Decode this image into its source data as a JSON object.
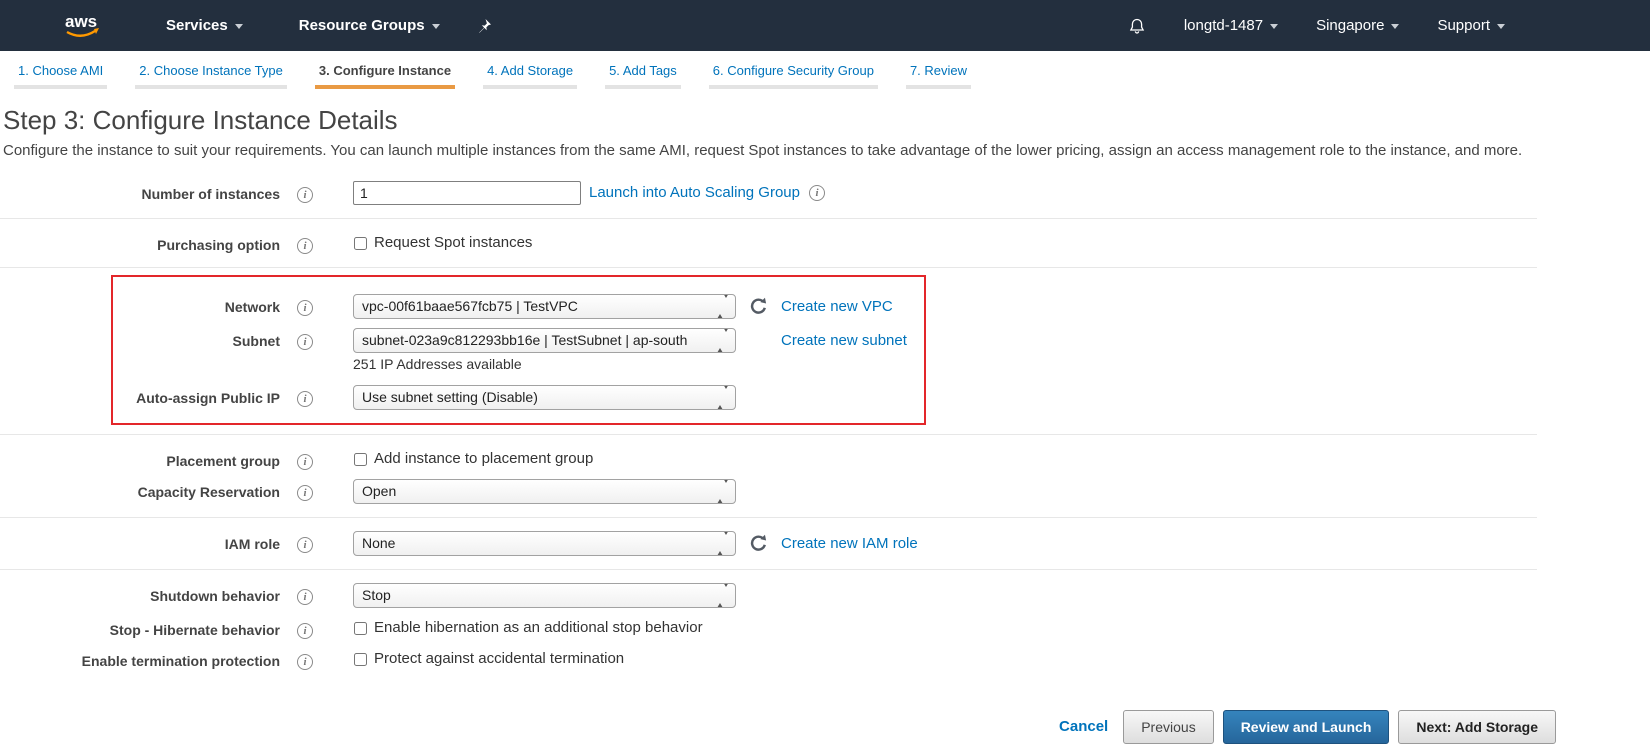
{
  "colors": {
    "nav_background": "#232f3e",
    "link_blue": "#0073bb",
    "active_tab_underline": "#e99a44",
    "annotation_red": "#e3262a",
    "primary_button_blue": "#2e77ae",
    "logo_orange": "#ff9900"
  },
  "topnav": {
    "logo_text": "aws",
    "services_label": "Services",
    "resource_groups_label": "Resource Groups",
    "account_label": "longtd-1487",
    "region_label": "Singapore",
    "support_label": "Support"
  },
  "wizard_tabs": [
    {
      "label": "1. Choose AMI",
      "active": false
    },
    {
      "label": "2. Choose Instance Type",
      "active": false
    },
    {
      "label": "3. Configure Instance",
      "active": true
    },
    {
      "label": "4. Add Storage",
      "active": false
    },
    {
      "label": "5. Add Tags",
      "active": false
    },
    {
      "label": "6. Configure Security Group",
      "active": false
    },
    {
      "label": "7. Review",
      "active": false
    }
  ],
  "page": {
    "title": "Step 3: Configure Instance Details",
    "description": "Configure the instance to suit your requirements. You can launch multiple instances from the same AMI, request Spot instances to take advantage of the lower pricing, assign an access management role to the instance, and more."
  },
  "form": {
    "number_of_instances": {
      "label": "Number of instances",
      "value": "1",
      "asg_link": "Launch into Auto Scaling Group"
    },
    "purchasing_option": {
      "label": "Purchasing option",
      "checkbox_label": "Request Spot instances"
    },
    "network": {
      "label": "Network",
      "value": "vpc-00f61baae567fcb75 | TestVPC",
      "link": "Create new VPC"
    },
    "subnet": {
      "label": "Subnet",
      "value": "subnet-023a9c812293bb16e | TestSubnet | ap-south",
      "link": "Create new subnet",
      "note": "251 IP Addresses available"
    },
    "auto_assign_public_ip": {
      "label": "Auto-assign Public IP",
      "value": "Use subnet setting (Disable)"
    },
    "placement_group": {
      "label": "Placement group",
      "checkbox_label": "Add instance to placement group"
    },
    "capacity_reservation": {
      "label": "Capacity Reservation",
      "value": "Open"
    },
    "iam_role": {
      "label": "IAM role",
      "value": "None",
      "link": "Create new IAM role"
    },
    "shutdown_behavior": {
      "label": "Shutdown behavior",
      "value": "Stop"
    },
    "hibernate_behavior": {
      "label": "Stop - Hibernate behavior",
      "checkbox_label": "Enable hibernation as an additional stop behavior"
    },
    "termination_protection": {
      "label": "Enable termination protection",
      "checkbox_label": "Protect against accidental termination"
    }
  },
  "footer": {
    "cancel_label": "Cancel",
    "previous_label": "Previous",
    "review_launch_label": "Review and Launch",
    "next_label": "Next: Add Storage"
  }
}
